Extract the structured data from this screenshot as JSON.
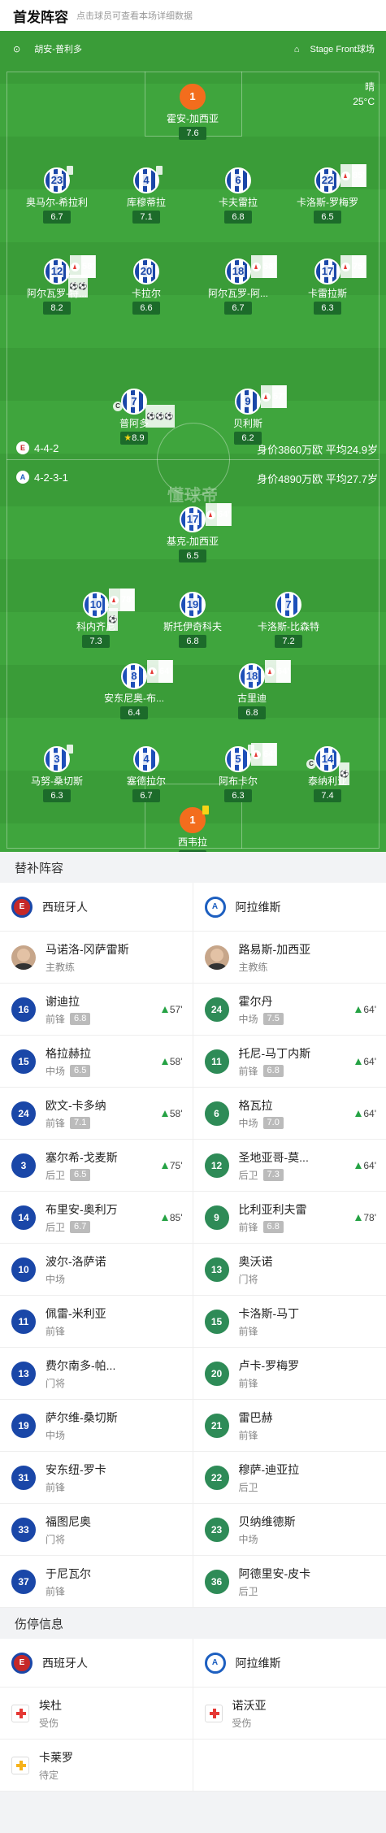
{
  "header": {
    "title": "首发阵容",
    "hint": "点击球员可查看本场详细数据"
  },
  "pitch_info": {
    "referee": "胡安-普利多",
    "stadium": "Stage Front球场",
    "weather": "晴",
    "temperature": "25°C",
    "watermark": "懂球帝"
  },
  "home_team": {
    "name": "西班牙人",
    "formation": "4-4-2",
    "value_line": "身价3860万欧 平均24.9岁"
  },
  "away_team": {
    "name": "阿拉维斯",
    "formation": "4-2-3-1",
    "value_line": "身价4890万欧 平均27.7岁"
  },
  "home_lineup": [
    {
      "num": "1",
      "name": "霍安-加西亚",
      "rating": "7.6",
      "gk": true
    },
    {
      "num": "23",
      "name": "奥马尔-希拉利",
      "rating": "6.7",
      "card": true
    },
    {
      "num": "4",
      "name": "库穆蒂拉",
      "rating": "7.1",
      "card": true
    },
    {
      "num": "6",
      "name": "卡夫雷拉",
      "rating": "6.8"
    },
    {
      "num": "22",
      "name": "卡洛斯-罗梅罗",
      "rating": "6.5",
      "sub": "85'"
    },
    {
      "num": "12",
      "name": "阿尔瓦罗-特...",
      "rating": "8.2",
      "sub": "58'",
      "balls": "⚽⚽"
    },
    {
      "num": "20",
      "name": "卡拉尔",
      "rating": "6.6"
    },
    {
      "num": "18",
      "name": "阿尔瓦罗-阿...",
      "rating": "6.7",
      "sub": "58'"
    },
    {
      "num": "17",
      "name": "卡雷拉斯",
      "rating": "6.3",
      "sub": "75'"
    },
    {
      "num": "7",
      "name": "普阿多",
      "rating": "8.9",
      "captain": true,
      "balls": "⚽⚽⚽",
      "star": true
    },
    {
      "num": "9",
      "name": "贝利斯",
      "rating": "6.2",
      "sub": "57'"
    }
  ],
  "away_lineup": [
    {
      "num": "17",
      "name": "基克-加西亚",
      "rating": "6.5",
      "sub": "64'"
    },
    {
      "num": "10",
      "name": "科内齐尼",
      "rating": "7.3",
      "sub": "78'",
      "balls": "⚽"
    },
    {
      "num": "19",
      "name": "斯托伊奇科夫",
      "rating": "6.8"
    },
    {
      "num": "7",
      "name": "卡洛斯-比森特",
      "rating": "7.2"
    },
    {
      "num": "8",
      "name": "安东尼奥-布...",
      "rating": "6.4",
      "sub": "64'"
    },
    {
      "num": "18",
      "name": "古里迪",
      "rating": "6.8",
      "sub": "64'"
    },
    {
      "num": "3",
      "name": "马努-桑切斯",
      "rating": "6.3",
      "card": true
    },
    {
      "num": "4",
      "name": "塞德拉尔",
      "rating": "6.7"
    },
    {
      "num": "5",
      "name": "阿布卡尔",
      "rating": "6.3",
      "card": true,
      "sub": "64'"
    },
    {
      "num": "14",
      "name": "泰纳利亚",
      "rating": "7.4",
      "captain": true,
      "balls": "⚽"
    },
    {
      "num": "1",
      "name": "西韦拉",
      "rating": "6.2",
      "gk": true,
      "card": true
    }
  ],
  "subs_section": {
    "title": "替补阵容"
  },
  "coaches": [
    {
      "name": "马诺洛-冈萨雷斯",
      "role": "主教练"
    },
    {
      "name": "路易斯-加西亚",
      "role": "主教练"
    }
  ],
  "subs": [
    [
      {
        "num": "16",
        "name": "谢迪拉",
        "pos": "前锋",
        "rating": "6.8",
        "time": "57'"
      },
      {
        "num": "24",
        "name": "霍尔丹",
        "pos": "中场",
        "rating": "7.5",
        "time": "64'"
      }
    ],
    [
      {
        "num": "15",
        "name": "格拉赫拉",
        "pos": "中场",
        "rating": "6.5",
        "time": "58'"
      },
      {
        "num": "11",
        "name": "托尼-马丁内斯",
        "pos": "前锋",
        "rating": "6.8",
        "time": "64'"
      }
    ],
    [
      {
        "num": "24",
        "name": "欧文-卡多纳",
        "pos": "前锋",
        "rating": "7.1",
        "time": "58'"
      },
      {
        "num": "6",
        "name": "格瓦拉",
        "pos": "中场",
        "rating": "7.0",
        "time": "64'"
      }
    ],
    [
      {
        "num": "3",
        "name": "塞尔希-戈麦斯",
        "pos": "后卫",
        "rating": "6.5",
        "time": "75'"
      },
      {
        "num": "12",
        "name": "圣地亚哥-莫...",
        "pos": "后卫",
        "rating": "7.3",
        "time": "64'"
      }
    ],
    [
      {
        "num": "14",
        "name": "布里安-奥利万",
        "pos": "后卫",
        "rating": "6.7",
        "time": "85'"
      },
      {
        "num": "9",
        "name": "比利亚利夫雷",
        "pos": "前锋",
        "rating": "6.8",
        "time": "78'"
      }
    ],
    [
      {
        "num": "10",
        "name": "波尔-洛萨诺",
        "pos": "中场"
      },
      {
        "num": "13",
        "name": "奥沃诺",
        "pos": "门将"
      }
    ],
    [
      {
        "num": "11",
        "name": "佩雷-米利亚",
        "pos": "前锋"
      },
      {
        "num": "15",
        "name": "卡洛斯-马丁",
        "pos": "前锋"
      }
    ],
    [
      {
        "num": "13",
        "name": "费尔南多-帕...",
        "pos": "门将"
      },
      {
        "num": "20",
        "name": "卢卡-罗梅罗",
        "pos": "前锋"
      }
    ],
    [
      {
        "num": "19",
        "name": "萨尔维-桑切斯",
        "pos": "中场"
      },
      {
        "num": "21",
        "name": "雷巴赫",
        "pos": "前锋"
      }
    ],
    [
      {
        "num": "31",
        "name": "安东纽-罗卡",
        "pos": "前锋"
      },
      {
        "num": "22",
        "name": "穆萨-迪亚拉",
        "pos": "后卫"
      }
    ],
    [
      {
        "num": "33",
        "name": "福图尼奥",
        "pos": "门将"
      },
      {
        "num": "23",
        "name": "贝纳维德斯",
        "pos": "中场"
      }
    ],
    [
      {
        "num": "37",
        "name": "于尼瓦尔",
        "pos": "前锋"
      },
      {
        "num": "36",
        "name": "阿德里安-皮卡",
        "pos": "后卫"
      }
    ]
  ],
  "injury_section": {
    "title": "伤停信息"
  },
  "injuries": [
    [
      {
        "name": "埃杜",
        "status": "受伤"
      },
      {
        "name": "诺沃亚",
        "status": "受伤"
      }
    ],
    [
      {
        "name": "卡莱罗",
        "status": "待定"
      },
      null
    ]
  ]
}
